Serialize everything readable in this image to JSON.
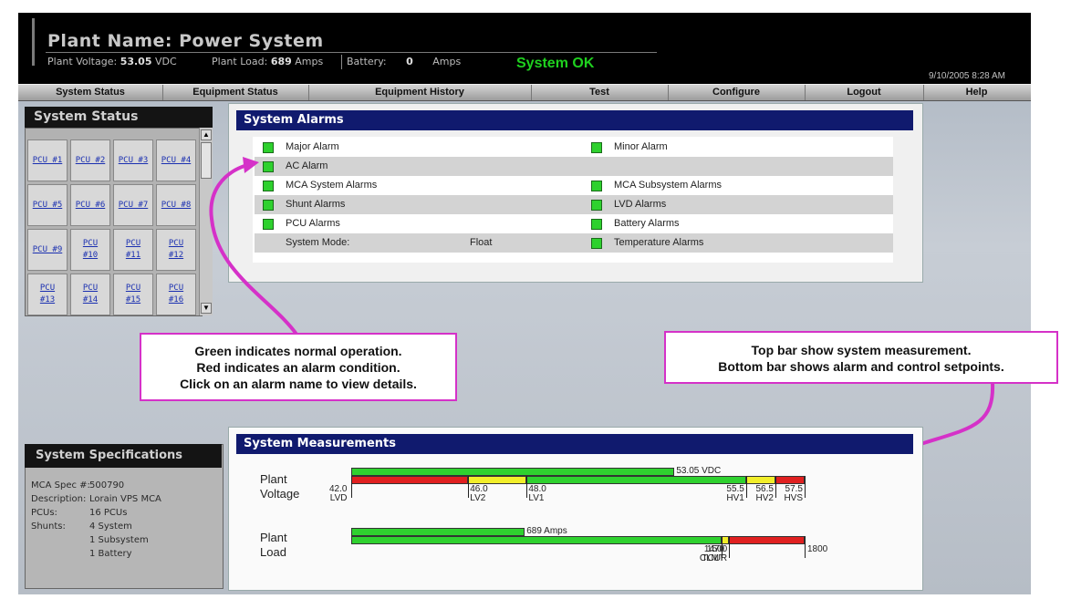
{
  "header": {
    "plant_title": "Plant Name: Power System",
    "voltage_label": "Plant Voltage:",
    "voltage_value": "53.05",
    "voltage_unit": "VDC",
    "load_label": "Plant Load:",
    "load_value": "689",
    "load_unit": "Amps",
    "battery_label": "Battery:",
    "battery_value": "0",
    "battery_unit": "Amps",
    "status": "System OK",
    "datetime": "9/10/2005 8:28 AM"
  },
  "nav": [
    "System Status",
    "Equipment Status",
    "Equipment History",
    "Test",
    "Configure",
    "Logout",
    "Help"
  ],
  "system_status": {
    "title": "System Status",
    "pcus": [
      [
        "PCU #1"
      ],
      [
        "PCU #2"
      ],
      [
        "PCU #3"
      ],
      [
        "PCU #4"
      ],
      [
        "PCU #5"
      ],
      [
        "PCU #6"
      ],
      [
        "PCU #7"
      ],
      [
        "PCU #8"
      ],
      [
        "PCU #9"
      ],
      [
        "PCU",
        "#10"
      ],
      [
        "PCU",
        "#11"
      ],
      [
        "PCU",
        "#12"
      ],
      [
        "PCU",
        "#13"
      ],
      [
        "PCU",
        "#14"
      ],
      [
        "PCU",
        "#15"
      ],
      [
        "PCU",
        "#16"
      ]
    ]
  },
  "alarms": {
    "title": "System Alarms",
    "rows": [
      {
        "left": "Major Alarm",
        "right": "Minor Alarm"
      },
      {
        "left": "AC Alarm",
        "right": ""
      },
      {
        "left": "MCA System Alarms",
        "right": "MCA Subsystem Alarms"
      },
      {
        "left": "Shunt Alarms",
        "right": "LVD Alarms"
      },
      {
        "left": "PCU Alarms",
        "right": "Battery Alarms"
      },
      {
        "left": "System Mode:",
        "mode_value": "Float",
        "right": "Temperature Alarms"
      }
    ],
    "led_color": "#2ed12e"
  },
  "callouts": {
    "left": [
      "Green indicates normal operation.",
      "Red indicates an alarm condition.",
      "Click on an alarm name to view details."
    ],
    "right": [
      "Top bar show system measurement.",
      "Bottom bar shows alarm and control setpoints."
    ],
    "border_color": "#d531c8"
  },
  "specs": {
    "title": "System Specifications",
    "rows": [
      {
        "label": "MCA Spec #:",
        "value": "500790"
      },
      {
        "label": "Description:",
        "value": "Lorain VPS MCA"
      },
      {
        "label": "PCUs:",
        "value": "16 PCUs"
      },
      {
        "label": "Shunts:",
        "value": "4 System"
      },
      {
        "label": "",
        "value": "1 Subsystem"
      },
      {
        "label": "",
        "value": "1 Battery"
      }
    ]
  },
  "measurements": {
    "title": "System Measurements",
    "voltage": {
      "label_line1": "Plant",
      "label_line2": "Voltage",
      "min": 42.0,
      "max": 57.5,
      "value": 53.05,
      "value_label": "53.05 VDC",
      "setpoints": [
        {
          "value": "42.0",
          "name": "LVD"
        },
        {
          "value": "46.0",
          "name": "LV2"
        },
        {
          "value": "48.0",
          "name": "LV1"
        },
        {
          "value": "55.5",
          "name": "HV1"
        },
        {
          "value": "56.5",
          "name": "HV2"
        },
        {
          "value": "57.5",
          "name": "HVS"
        }
      ],
      "zones": [
        {
          "from": 42.0,
          "to": 46.0,
          "color": "#e02020"
        },
        {
          "from": 46.0,
          "to": 48.0,
          "color": "#f2ee2a"
        },
        {
          "from": 48.0,
          "to": 55.5,
          "color": "#2fd12f"
        },
        {
          "from": 55.5,
          "to": 56.5,
          "color": "#f2ee2a"
        },
        {
          "from": 56.5,
          "to": 57.5,
          "color": "#e02020"
        }
      ]
    },
    "load": {
      "label_line1": "Plant",
      "label_line2": "Load",
      "min": 0,
      "max": 1800,
      "value": 689,
      "value_label": "689 Amps",
      "setpoints": [
        {
          "value": "1470",
          "name": "CLMT"
        },
        {
          "value": "1500",
          "name": "TCUR"
        },
        {
          "value": "1800",
          "name": ""
        }
      ],
      "zones": [
        {
          "from": 0,
          "to": 1470,
          "color": "#2fd12f"
        },
        {
          "from": 1470,
          "to": 1500,
          "color": "#f2ee2a"
        },
        {
          "from": 1500,
          "to": 1800,
          "color": "#e02020"
        }
      ]
    }
  }
}
